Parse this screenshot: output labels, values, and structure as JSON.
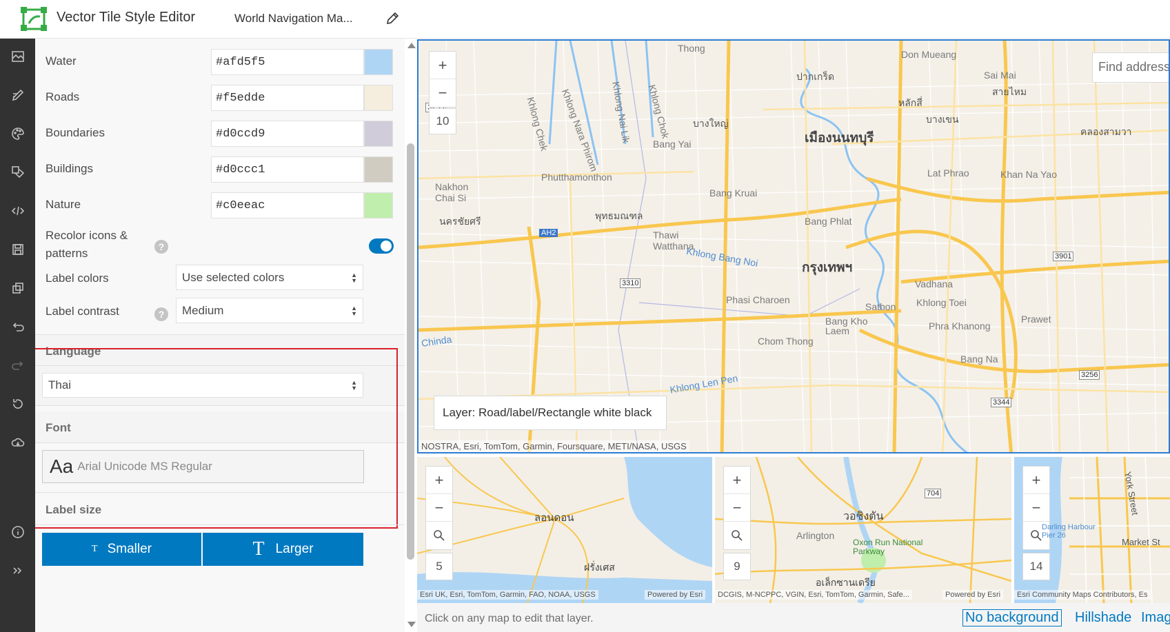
{
  "header": {
    "app_title": "Vector Tile Style Editor",
    "doc_title": "World Navigation Ma...",
    "logo_icon": "esri-vtse-logo-icon",
    "edit_icon": "pencil-icon"
  },
  "rail": {
    "items": [
      {
        "icon": "basemap-icon"
      },
      {
        "icon": "edit-style-icon"
      },
      {
        "icon": "palette-icon"
      },
      {
        "icon": "layers-icon"
      },
      {
        "icon": "code-icon"
      },
      {
        "icon": "save-icon"
      },
      {
        "icon": "copy-icon"
      },
      {
        "icon": "undo-icon"
      },
      {
        "icon": "redo-icon"
      },
      {
        "icon": "reset-icon"
      },
      {
        "icon": "download-icon"
      },
      {
        "icon": "info-icon"
      },
      {
        "icon": "expand-icon"
      }
    ]
  },
  "colors": [
    {
      "label": "Water",
      "value": "#afd5f5",
      "swatch": "#afd5f5"
    },
    {
      "label": "Roads",
      "value": "#f5edde",
      "swatch": "#f5edde"
    },
    {
      "label": "Boundaries",
      "value": "#d0ccd9",
      "swatch": "#d0ccd9"
    },
    {
      "label": "Buildings",
      "value": "#d0ccc1",
      "swatch": "#d0ccc1"
    },
    {
      "label": "Nature",
      "value": "#c0eeac",
      "swatch": "#c0eeac"
    }
  ],
  "recolor": {
    "label_line1": "Recolor icons &",
    "label_line2": "patterns",
    "on": true
  },
  "label_colors": {
    "label": "Label colors",
    "value": "Use selected colors"
  },
  "label_contrast": {
    "label": "Label contrast",
    "value": "Medium"
  },
  "language": {
    "header": "Language",
    "value": "Thai"
  },
  "font": {
    "header": "Font",
    "sample": "Aa",
    "value": "Arial Unicode MS Regular"
  },
  "label_size": {
    "header": "Label size",
    "smaller": "Smaller",
    "larger": "Larger",
    "smaller_glyph": "T",
    "larger_glyph": "T"
  },
  "main_map": {
    "zoom_level": "10",
    "find_placeholder": "Find address",
    "layer_tip": "Layer: Road/label/Rectangle white black",
    "attribution": "NOSTRA, Esri, TomTom, Garmin, Foursquare, METI/NASA, USGS",
    "labels": {
      "thong": "Thong",
      "don_mueang": "Don Mueang",
      "pak_kret": "ปากเกร็ด",
      "sai_mai": "Sai Mai",
      "khlong_chek": "Khlong Chek",
      "khlong_nara": "Khlong Nara Phirom",
      "khlong_nai_lik": "Khlong Nai Lik",
      "khlong_chok": "Khlong Chok",
      "bang_yai_th": "บางใหญ่",
      "bang_yai": "Bang Yai",
      "mueang_nonthaburi": "เมืองนนทบุรี",
      "phutthamonthon": "Phutthamonthon",
      "nakhon_chai_si": "Nakhon\nChai Si",
      "bang_kruai": "Bang Kruai",
      "lat_phrao": "Lat Phrao",
      "khan_na_yao": "Khan Na Yao",
      "nakhon_chaisi_th": "นครชัยศรี",
      "phutthamonthon_th": "พุทธมณฑล",
      "thawi_watthana": "Thawi\nWatthana",
      "bang_phlat": "Bang Phlat",
      "krung_thep": "กรุงเทพฯ",
      "khlong_bang_noi": "Khlong Bang Noi",
      "vadhana": "Vadhana",
      "phasi_charoen": "Phasi Charoen",
      "sathon": "Sathon",
      "khlong_toei": "Khlong Toei",
      "bang_kho_laem": "Bang Kho\nLaem",
      "phra_khanong": "Phra Khanong",
      "prawet": "Prawet",
      "chinda": "Chinda",
      "chom_thong": "Chom Thong",
      "bang_na": "Bang Na",
      "khlong_len": "Khlong Len Pen",
      "sai_mai_th": "สายไหม",
      "lak_si": "หลักสี่",
      "bang_khen": "บางเขน",
      "khlong_sam_wa": "คลองสามวา",
      "road_3233": "3233",
      "road_ah2": "AH2",
      "road_3310": "3310",
      "road_3901": "3901",
      "road_3256": "3256",
      "road_3344": "3344"
    }
  },
  "mini_maps": [
    {
      "zoom": "5",
      "attr_left": "Esri UK, Esri, TomTom, Garmin, FAO, NOAA, USGS",
      "attr_right": "Powered by Esri",
      "city": "ลอนดอน",
      "city2": "ฝรั่งเศส"
    },
    {
      "zoom": "9",
      "attr_left": "DCGIS, M-NCPPC, VGIN, Esri, TomTom, Garmin, Safe...",
      "attr_right": "Powered by Esri",
      "city": "วอชิงตัน",
      "arlington": "Arlington",
      "oxon": "Oxon Run National\nParkway",
      "alexandria": "อเล็กซานเดรีย",
      "road": "704"
    },
    {
      "zoom": "14",
      "attr_left": "Esri Community Maps Contributors, Es",
      "street": "York Street",
      "market": "Market St",
      "harbour": "Darling Harbour\nPier 26"
    }
  ],
  "status": {
    "text": "Click on any map to edit that layer."
  },
  "background_options": [
    "No background",
    "Hillshade",
    "Imag"
  ]
}
